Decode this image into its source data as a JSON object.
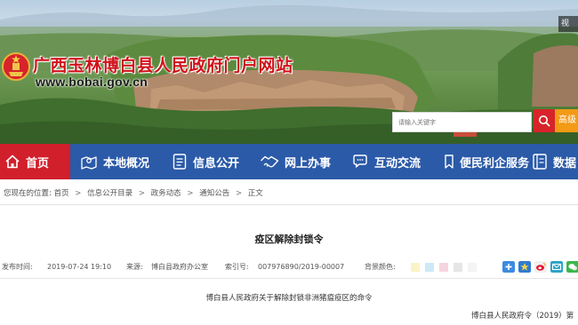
{
  "site": {
    "title": "广西玉林博白县人民政府门户网站",
    "url": "www.bobai.gov.cn",
    "corner_tag": "视"
  },
  "search": {
    "placeholder": "请输入关键字",
    "advanced_label": "高级"
  },
  "nav": {
    "items": [
      {
        "label": "首页",
        "icon": "home-icon",
        "active": true
      },
      {
        "label": "本地概况",
        "icon": "map-pin-icon"
      },
      {
        "label": "信息公开",
        "icon": "document-list-icon"
      },
      {
        "label": "网上办事",
        "icon": "handshake-icon"
      },
      {
        "label": "互动交流",
        "icon": "chat-bubbles-icon"
      },
      {
        "label": "便民利企服务",
        "icon": "bookmark-icon"
      },
      {
        "label": "数据",
        "icon": "data-book-icon"
      }
    ]
  },
  "breadcrumb": {
    "prefix": "您现在的位置:",
    "items": [
      "首页",
      "信息公开目录",
      "政务动态",
      "通知公告",
      "正文"
    ],
    "separator": ">"
  },
  "article": {
    "title": "疫区解除封锁令",
    "meta": {
      "date_label": "发布时间:",
      "date": "2019-07-24 19:10",
      "source_label": "来源:",
      "source": "博白县政府办公室",
      "index_label": "索引号:",
      "index": "007976890/2019-00007",
      "bg_label": "背景颜色:"
    },
    "bg_colors": [
      "#fbf3c7",
      "#cde8f6",
      "#f7d5df",
      "#e6e6e6",
      "#f4f4f4"
    ],
    "doc_heading": "博白县人民政府关于解除封锁非洲猪瘟疫区的命令",
    "doc_number": "博白县人民政府令（2019）第"
  },
  "share_icons": [
    "plus-share-icon",
    "star-share-icon",
    "weibo-share-icon",
    "email-share-icon",
    "wechat-share-icon"
  ],
  "colors": {
    "nav_bg": "#2b5aa8",
    "nav_active": "#d11f2b",
    "title_red": "#d0121b",
    "search_button": "#d7232a"
  }
}
